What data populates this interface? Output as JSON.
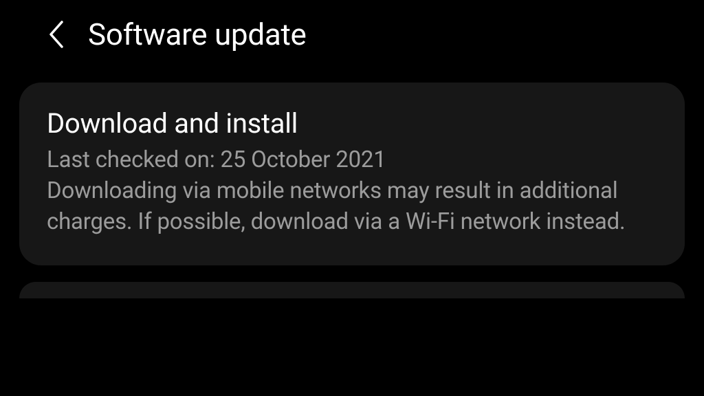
{
  "header": {
    "title": "Software update"
  },
  "card": {
    "title": "Download and install",
    "last_checked": "Last checked on: 25 October 2021",
    "description": "Downloading via mobile networks may result in additional charges. If possible, download via a Wi-Fi network instead."
  }
}
